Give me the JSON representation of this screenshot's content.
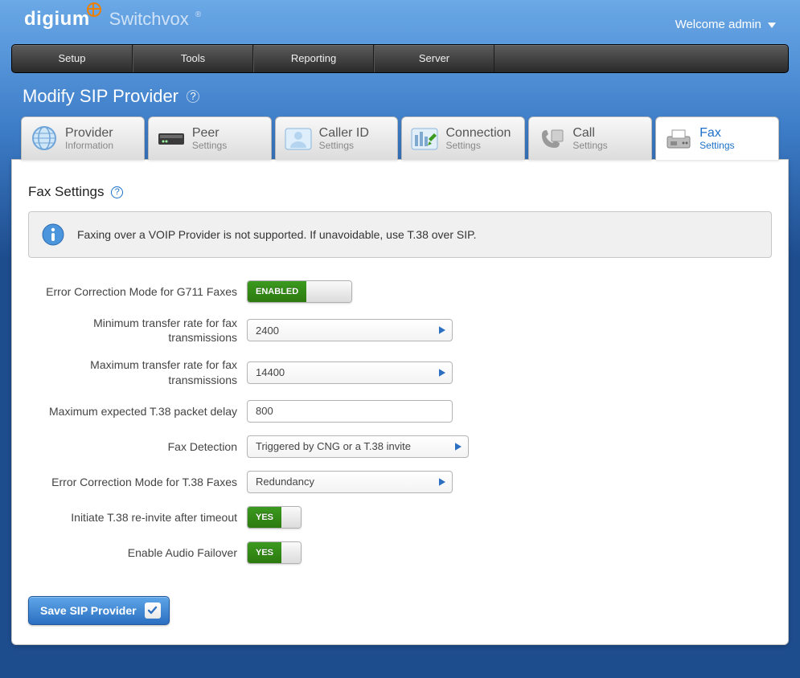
{
  "branding": {
    "logo": "digium",
    "product": "Switchvox"
  },
  "welcome": "Welcome admin",
  "nav": [
    "Setup",
    "Tools",
    "Reporting",
    "Server"
  ],
  "page_title": "Modify SIP Provider",
  "tabs": [
    {
      "big": "Provider",
      "small": "Information"
    },
    {
      "big": "Peer",
      "small": "Settings"
    },
    {
      "big": "Caller ID",
      "small": "Settings"
    },
    {
      "big": "Connection",
      "small": "Settings"
    },
    {
      "big": "Call",
      "small": "Settings"
    },
    {
      "big": "Fax",
      "small": "Settings"
    }
  ],
  "section_title": "Fax Settings",
  "info_text": "Faxing over a VOIP Provider is not supported. If unavoidable, use T.38 over SIP.",
  "fields": {
    "ecm_g711_label": "Error Correction Mode for G711 Faxes",
    "ecm_g711_value": "ENABLED",
    "min_rate_label": "Minimum transfer rate for fax transmissions",
    "min_rate_value": "2400",
    "max_rate_label": "Maximum transfer rate for fax transmissions",
    "max_rate_value": "14400",
    "t38_delay_label": "Maximum expected T.38 packet delay",
    "t38_delay_value": "800",
    "detect_label": "Fax Detection",
    "detect_value": "Triggered by CNG or a T.38 invite",
    "ecm_t38_label": "Error Correction Mode for T.38 Faxes",
    "ecm_t38_value": "Redundancy",
    "reinvite_label": "Initiate T.38 re-invite after timeout",
    "reinvite_value": "YES",
    "failover_label": "Enable Audio Failover",
    "failover_value": "YES"
  },
  "save_label": "Save SIP Provider"
}
